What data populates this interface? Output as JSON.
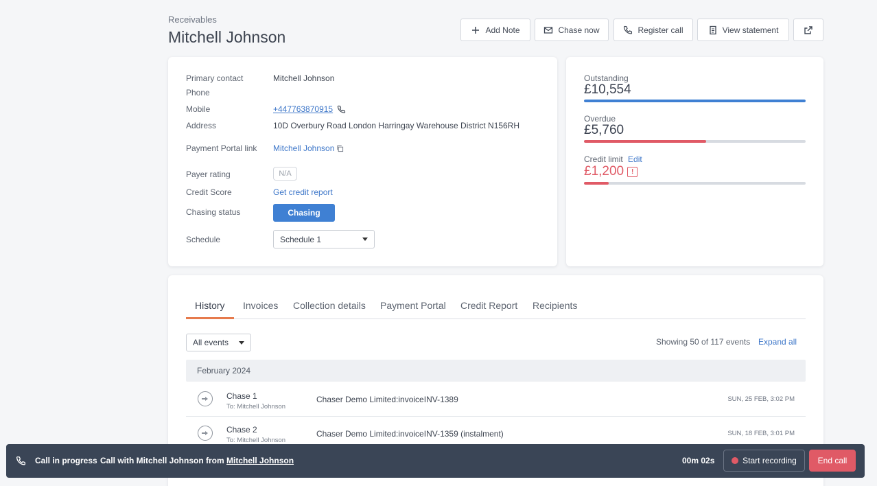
{
  "header": {
    "breadcrumb": "Receivables",
    "title": "Mitchell Johnson",
    "actions": {
      "add_note": "Add Note",
      "chase_now": "Chase now",
      "register_call": "Register call",
      "view_statement": "View statement"
    }
  },
  "contact": {
    "primary_contact_label": "Primary contact",
    "primary_contact": "Mitchell Johnson",
    "phone_label": "Phone",
    "mobile_label": "Mobile",
    "mobile": "+447763870915",
    "address_label": "Address",
    "address": "10D Overbury Road London Harringay Warehouse District N156RH",
    "portal_label": "Payment Portal link",
    "portal_link": "Mitchell Johnson",
    "payer_rating_label": "Payer rating",
    "payer_rating": "N/A",
    "credit_score_label": "Credit Score",
    "credit_score_link": "Get credit report",
    "chasing_status_label": "Chasing status",
    "chasing_status": "Chasing",
    "schedule_label": "Schedule",
    "schedule": "Schedule 1"
  },
  "summary": {
    "outstanding_label": "Outstanding",
    "outstanding": "£10,554",
    "outstanding_fraction": 1.0,
    "overdue_label": "Overdue",
    "overdue": "£5,760",
    "overdue_fraction": 0.55,
    "credit_limit_label": "Credit limit",
    "credit_limit_edit": "Edit",
    "credit_limit": "£1,200",
    "credit_limit_warning": "!",
    "credit_limit_fraction": 0.11
  },
  "colors": {
    "primary": "#3f80d3",
    "danger": "#e05a66",
    "tab_accent": "#e67a4c",
    "callbar_bg": "#3a4556"
  },
  "tabs": [
    {
      "label": "History",
      "active": true
    },
    {
      "label": "Invoices",
      "active": false
    },
    {
      "label": "Collection details",
      "active": false
    },
    {
      "label": "Payment Portal",
      "active": false
    },
    {
      "label": "Credit Report",
      "active": false
    },
    {
      "label": "Recipients",
      "active": false
    }
  ],
  "history": {
    "filter": "All events",
    "count_text": "Showing 50 of 117 events",
    "expand_all": "Expand all",
    "month": "February 2024",
    "events": [
      {
        "name": "Chase 1",
        "to": "To: Mitchell Johnson",
        "description": "Chaser Demo Limited:invoiceINV-1389",
        "date": "SUN, 25 FEB, 3:02 PM",
        "icon": "chase-arrow-icon"
      },
      {
        "name": "Chase 2",
        "to": "To: Mitchell Johnson",
        "description": "Chaser Demo Limited:invoiceINV-1359 (instalment)",
        "date": "SUN, 18 FEB, 3:01 PM",
        "icon": "chase-arrow-icon"
      }
    ]
  },
  "call": {
    "status": "Call in progress",
    "text_prefix": "Call with Mitchell Johnson from",
    "from_link": "Mitchell Johnson",
    "timer": "00m 02s",
    "start_recording": "Start recording",
    "end_call": "End call"
  }
}
